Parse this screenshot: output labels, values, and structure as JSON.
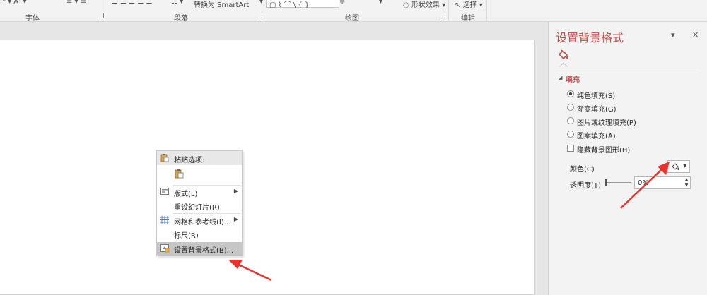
{
  "ribbon": {
    "groups": [
      {
        "label": "字体"
      },
      {
        "label": "段落"
      },
      {
        "label": "绘图"
      },
      {
        "label": "编辑"
      }
    ],
    "convert_smartart": "转换为 SmartArt",
    "shape_effects": "形状效果",
    "select": "选择"
  },
  "context_menu": {
    "paste_header": "粘贴选项:",
    "items": [
      {
        "label": "版式(L)",
        "submenu": true
      },
      {
        "label": "重设幻灯片(R)",
        "submenu": false
      },
      {
        "label": "网格和参考线(I)...",
        "submenu": true
      },
      {
        "label": "标尺(R)",
        "submenu": false
      },
      {
        "label": "设置背景格式(B)...",
        "submenu": false,
        "highlighted": true
      }
    ]
  },
  "pane": {
    "title": "设置背景格式",
    "section": "填充",
    "fill_options": [
      {
        "label": "纯色填充(S)",
        "selected": true
      },
      {
        "label": "渐变填充(G)",
        "selected": false
      },
      {
        "label": "图片或纹理填充(P)",
        "selected": false
      },
      {
        "label": "图案填充(A)",
        "selected": false
      }
    ],
    "hide_bg_graphics": "隐藏背景图形(H)",
    "color_label": "颜色(C)",
    "transparency_label": "透明度(T)",
    "transparency_value": "0%"
  },
  "colors": {
    "accent": "#c0504d",
    "arrow": "#e8322b"
  }
}
